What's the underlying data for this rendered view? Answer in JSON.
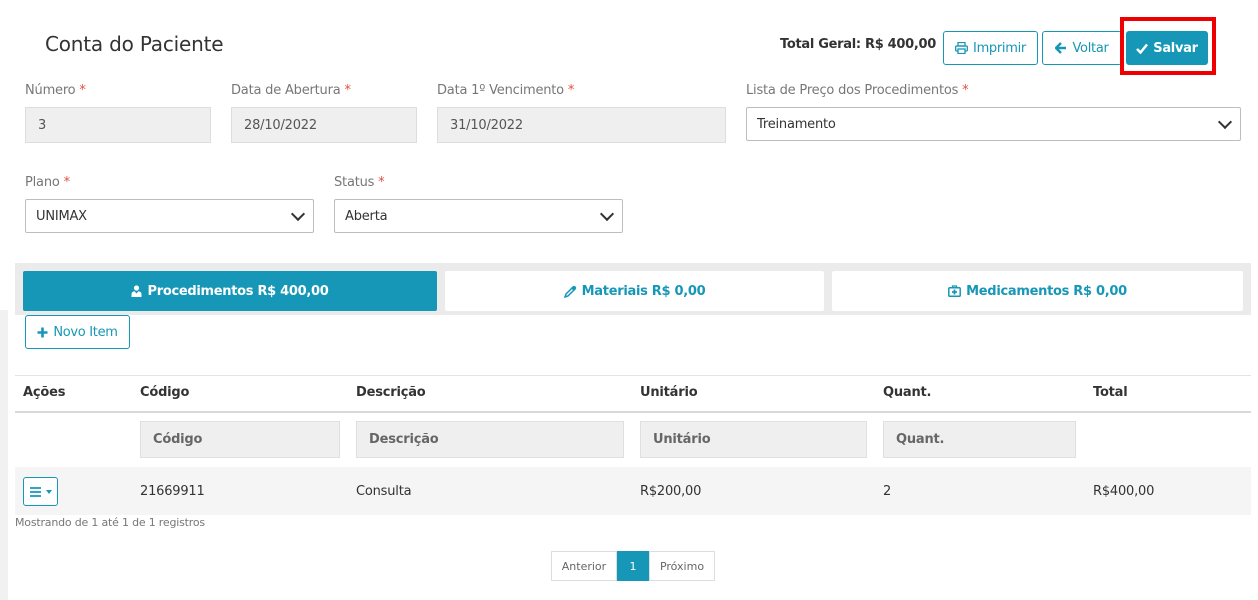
{
  "header": {
    "title": "Conta do Paciente",
    "total_label": "Total Geral: R$ 400,00",
    "buttons": {
      "imprimir": "Imprimir",
      "voltar": "Voltar",
      "salvar": "Salvar"
    }
  },
  "form": {
    "numero": {
      "label": "Número",
      "value": "3"
    },
    "data_abertura": {
      "label": "Data de Abertura",
      "value": "28/10/2022"
    },
    "data_vencimento": {
      "label": "Data 1º Vencimento",
      "value": "31/10/2022"
    },
    "lista_preco": {
      "label": "Lista de Preço dos Procedimentos",
      "value": "Treinamento"
    },
    "plano": {
      "label": "Plano",
      "value": "UNIMAX"
    },
    "status": {
      "label": "Status",
      "value": "Aberta"
    },
    "required_mark": "*"
  },
  "tabs": [
    {
      "label": "Procedimentos R$ 400,00",
      "icon": "user-md-icon",
      "active": true
    },
    {
      "label": "Materiais R$ 0,00",
      "icon": "eyedropper-icon",
      "active": false
    },
    {
      "label": "Medicamentos R$ 0,00",
      "icon": "medkit-icon",
      "active": false
    }
  ],
  "actions": {
    "novo_item": "Novo Item"
  },
  "table": {
    "columns": [
      "Ações",
      "Código",
      "Descrição",
      "Unitário",
      "Quant.",
      "Total"
    ],
    "filters": {
      "codigo": "Código",
      "descricao": "Descrição",
      "unitario": "Unitário",
      "quant": "Quant."
    },
    "rows": [
      {
        "codigo": "21669911",
        "descricao": "Consulta",
        "unitario": "R$200,00",
        "quant": "2",
        "total": "R$400,00"
      }
    ],
    "info": "Mostrando de 1 até 1 de 1 registros"
  },
  "pagination": {
    "prev": "Anterior",
    "current": "1",
    "next": "Próximo"
  },
  "colors": {
    "accent": "#1797b7",
    "highlight": "#ef0000",
    "required": "#e74c3c"
  }
}
